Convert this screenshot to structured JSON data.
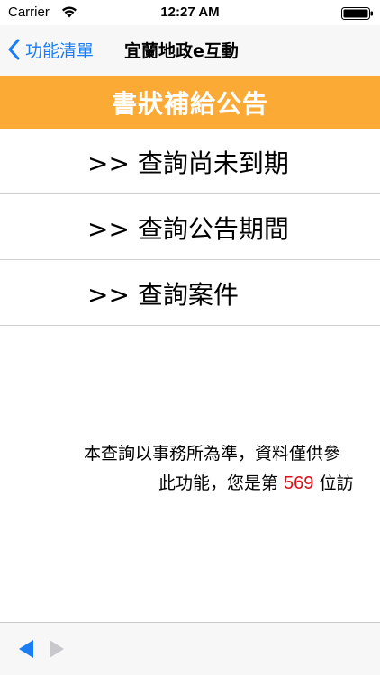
{
  "status_bar": {
    "carrier": "Carrier",
    "time": "12:27 AM"
  },
  "nav": {
    "back_label": "功能清單",
    "title": "宜蘭地政e互動"
  },
  "header": {
    "title": "書狀補給公告",
    "color": "#fbaa35"
  },
  "menu": {
    "items": [
      {
        "label": ">> 查詢尚未到期"
      },
      {
        "label": ">> 查詢公告期間"
      },
      {
        "label": ">> 查詢案件"
      }
    ]
  },
  "notice": {
    "line1": "本查詢以事務所為準，資料僅供參",
    "line2_prefix": "此功能，您是第 ",
    "visitor_count": "569",
    "line2_suffix": " 位訪"
  },
  "toolbar": {
    "prev_color": "#1a7df5",
    "next_color": "#c7c7cc"
  },
  "accent_color": "#1a7df5"
}
